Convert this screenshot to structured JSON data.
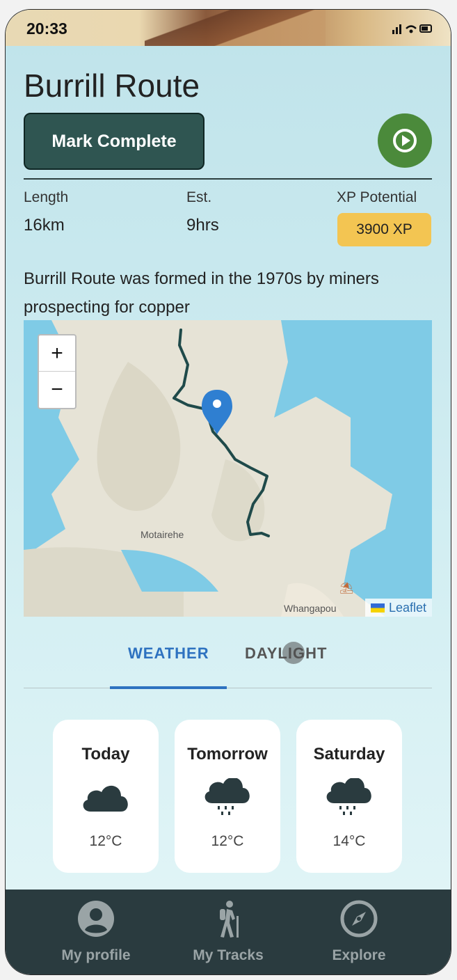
{
  "status_bar": {
    "time": "20:33",
    "indicators": "signal wifi battery"
  },
  "route": {
    "title": "Burrill Route",
    "mark_complete_label": "Mark Complete",
    "stats": {
      "length_label": "Length",
      "length_value": "16km",
      "est_label": "Est.",
      "est_value": "9hrs",
      "xp_label": "XP Potential",
      "xp_value": "3900 XP"
    },
    "description": "Burrill Route was formed in the 1970s by miners prospecting for copper"
  },
  "map": {
    "zoom_in": "+",
    "zoom_out": "−",
    "place_labels": {
      "motairehe": "Motairehe",
      "whangapoua": "Whangapou"
    },
    "attribution": "Leaflet"
  },
  "tabs": [
    {
      "label": "WEATHER",
      "active": true
    },
    {
      "label": "DAYLIGHT",
      "active": false
    }
  ],
  "weather": [
    {
      "day": "Today",
      "icon": "cloud-icon",
      "temp": "12°C"
    },
    {
      "day": "Tomorrow",
      "icon": "rain-cloud-icon",
      "temp": "12°C"
    },
    {
      "day": "Saturday",
      "icon": "rain-cloud-icon",
      "temp": "14°C"
    }
  ],
  "nav": [
    {
      "label": "My profile",
      "icon": "profile-icon"
    },
    {
      "label": "My Tracks",
      "icon": "hiker-icon"
    },
    {
      "label": "Explore",
      "icon": "compass-icon"
    }
  ],
  "colors": {
    "primary_dark": "#2f5551",
    "play_green": "#4b8a3b",
    "xp_yellow": "#f3c552",
    "tab_blue": "#2e72c0",
    "nav_bg": "#2a3b3f",
    "route_line": "#1f4a4a",
    "marker_blue": "#2f7fd1"
  }
}
